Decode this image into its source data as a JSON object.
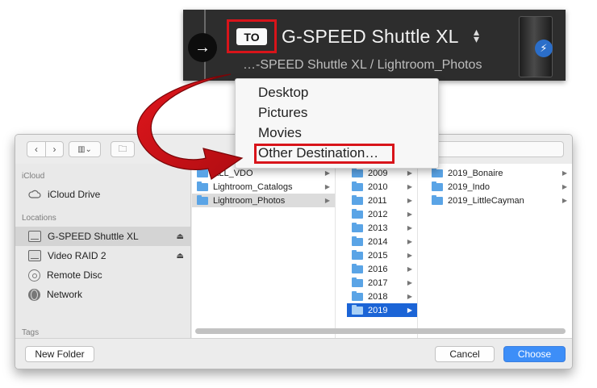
{
  "to_bar": {
    "to_label": "TO",
    "destination_name": "G-SPEED Shuttle XL",
    "destination_path": "…-SPEED Shuttle XL / Lightroom_Photos"
  },
  "menu": {
    "items": [
      {
        "label": "Desktop"
      },
      {
        "label": "Pictures"
      },
      {
        "label": "Movies"
      },
      {
        "label": "Other Destination…"
      }
    ]
  },
  "sidebar": {
    "sections": [
      {
        "title": "iCloud",
        "items": [
          {
            "label": "iCloud Drive",
            "icon": "cloud-icon"
          }
        ]
      },
      {
        "title": "Locations",
        "items": [
          {
            "label": "G-SPEED Shuttle XL",
            "icon": "drive-icon",
            "selected": true,
            "eject": true
          },
          {
            "label": "Video RAID 2",
            "icon": "drive-icon",
            "eject": true
          },
          {
            "label": "Remote Disc",
            "icon": "disc-icon"
          },
          {
            "label": "Network",
            "icon": "globe-icon"
          }
        ]
      },
      {
        "title": "Tags",
        "items": []
      }
    ]
  },
  "columns": {
    "col1": [
      "ALL_VDO",
      "Lightroom_Catalogs",
      "Lightroom_Photos"
    ],
    "col2": [
      "2009",
      "2010",
      "2011",
      "2012",
      "2013",
      "2014",
      "2015",
      "2016",
      "2017",
      "2018",
      "2019"
    ],
    "col3": [
      "2019_Bonaire",
      "2019_Indo",
      "2019_LittleCayman"
    ]
  },
  "buttons": {
    "new_folder": "New Folder",
    "cancel": "Cancel",
    "choose": "Choose"
  },
  "colors": {
    "accent_red": "#d8141a",
    "selection_blue": "#1b64d6",
    "primary_button": "#3d8ef8"
  }
}
